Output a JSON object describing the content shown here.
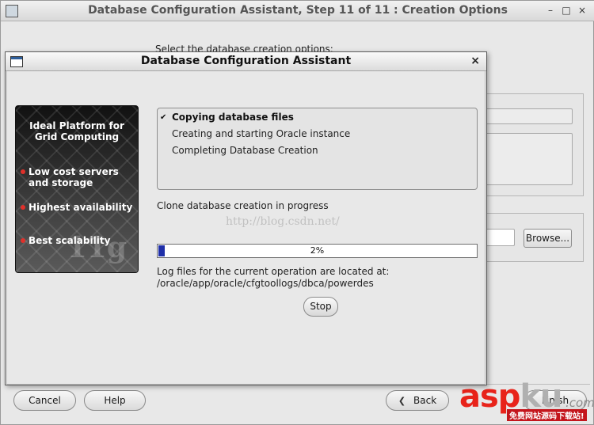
{
  "background_window": {
    "title": "Database Configuration Assistant, Step 11 of 11 : Creation Options",
    "select_text": "Select the database creation options:",
    "controls": {
      "minimize": "–",
      "maximize": "□",
      "close": "×"
    },
    "browse_label": "Browse...",
    "buttons": {
      "cancel": "Cancel",
      "help": "Help",
      "back": "Back",
      "finish": "Finish"
    }
  },
  "dialog": {
    "title": "Database Configuration Assistant",
    "close_glyph": "×",
    "side_panel": {
      "title_line1": "Ideal Platform for",
      "title_line2": "Grid Computing",
      "items": [
        {
          "line1": "Low cost servers",
          "line2": "and storage"
        },
        {
          "line1": "Highest availability",
          "line2": ""
        },
        {
          "line1": "Best scalability",
          "line2": ""
        }
      ],
      "logo_text": "11g"
    },
    "steps": [
      {
        "label": "Copying database files",
        "active": true
      },
      {
        "label": "Creating and starting Oracle instance",
        "active": false
      },
      {
        "label": "Completing Database Creation",
        "active": false
      }
    ],
    "status_text": "Clone database creation in progress",
    "progress": {
      "percent": 2,
      "label": "2%"
    },
    "log_line1": "Log files for the current operation are located at:",
    "log_line2": "/oracle/app/oracle/cfgtoollogs/dbca/powerdes",
    "stop_label": "Stop"
  },
  "overlay_url": "http://blog.csdn.net/",
  "watermark": {
    "red": "asp",
    "grey": "ku",
    "suffix": ".com",
    "tagline": "免费网站源码下载站!"
  }
}
